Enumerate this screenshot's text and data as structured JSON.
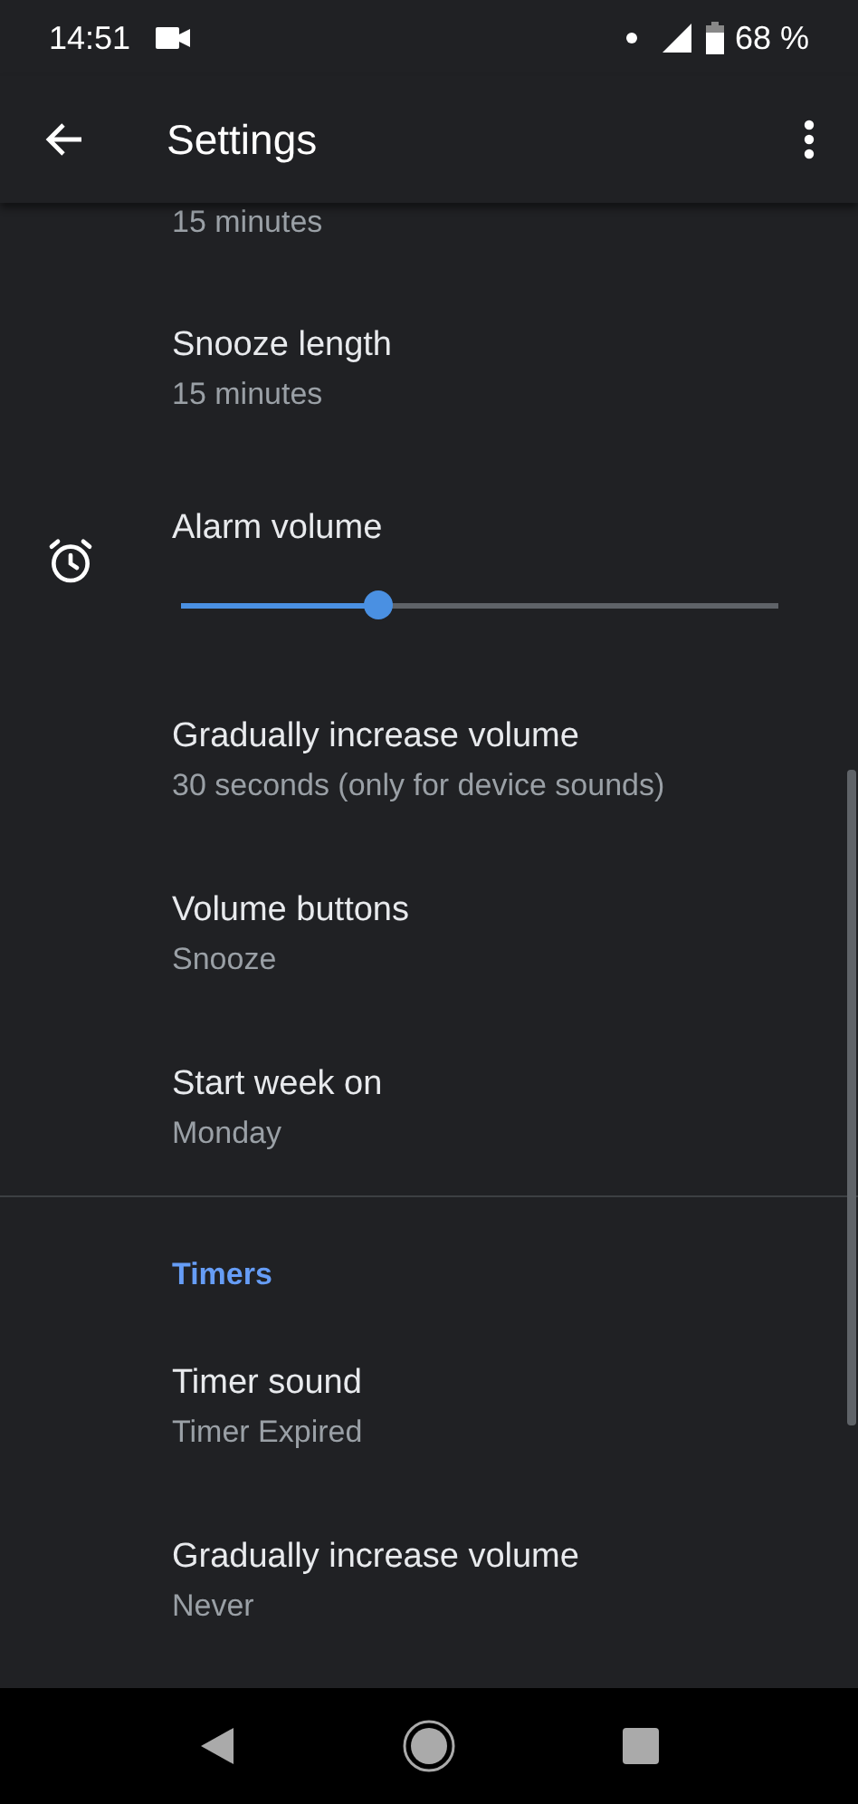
{
  "status_bar": {
    "time": "14:51",
    "battery": "68 %"
  },
  "app_bar": {
    "title": "Settings"
  },
  "items": [
    {
      "kind": "partial",
      "subtitle": "15 minutes"
    },
    {
      "kind": "text",
      "title": "Snooze length",
      "subtitle": "15 minutes"
    },
    {
      "kind": "slider",
      "title": "Alarm volume",
      "level": 0.33
    },
    {
      "kind": "text",
      "title": "Gradually increase volume",
      "subtitle": "30 seconds (only for device sounds)"
    },
    {
      "kind": "text",
      "title": "Volume buttons",
      "subtitle": "Snooze"
    },
    {
      "kind": "text",
      "title": "Start week on",
      "subtitle": "Monday"
    },
    {
      "kind": "divider"
    },
    {
      "kind": "header",
      "title": "Timers"
    },
    {
      "kind": "text",
      "title": "Timer sound",
      "subtitle": "Timer Expired"
    },
    {
      "kind": "text",
      "title": "Gradually increase volume",
      "subtitle": "Never"
    }
  ]
}
